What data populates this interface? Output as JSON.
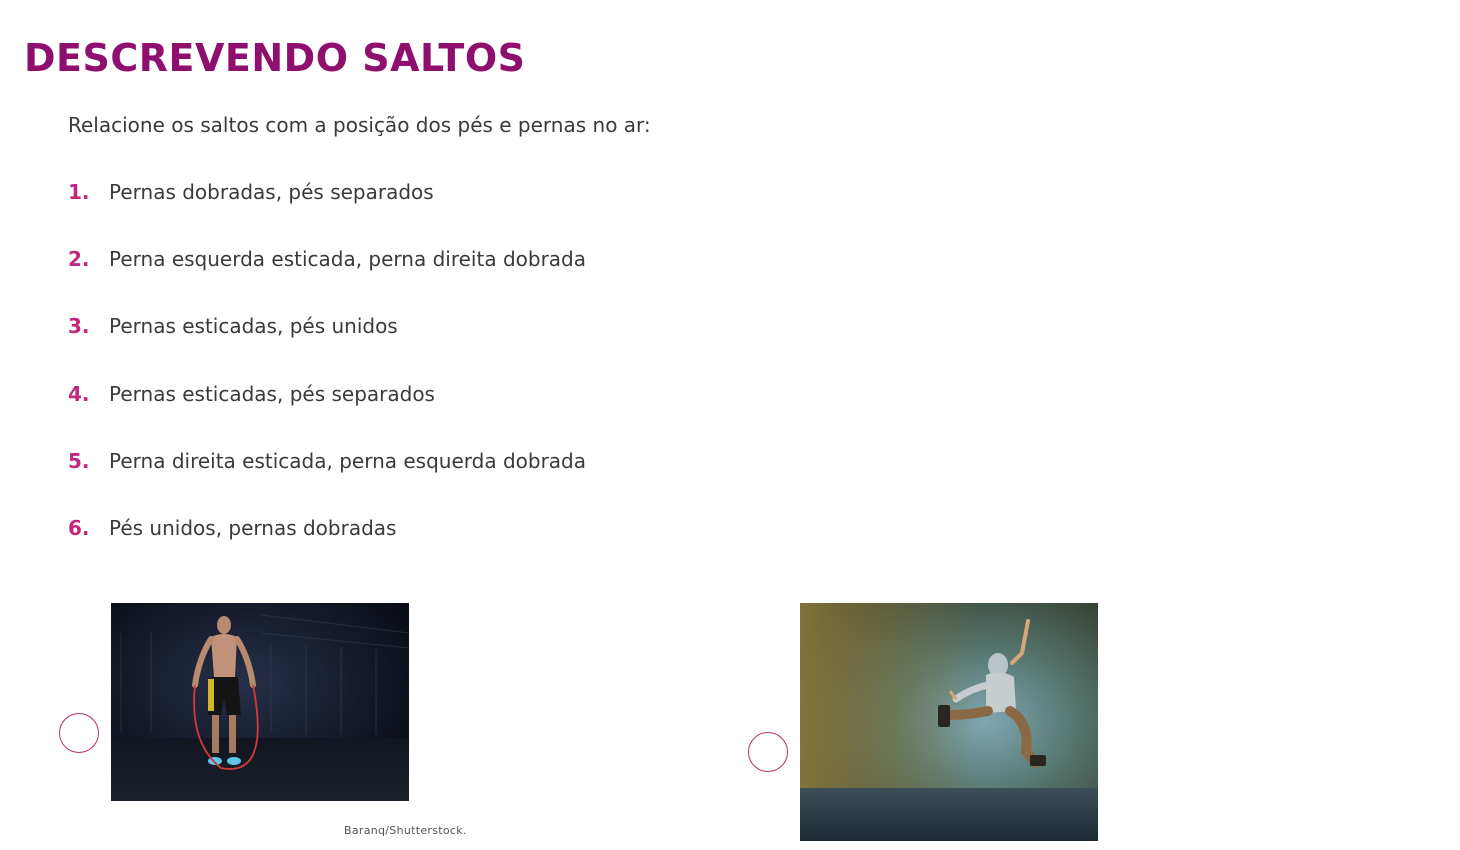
{
  "title": "DESCREVENDO SALTOS",
  "instruction": "Relacione os saltos com a posição dos pés e pernas no ar:",
  "options": [
    {
      "number": "1.",
      "text": "Pernas dobradas, pés separados"
    },
    {
      "number": "2.",
      "text": "Perna esquerda esticada, perna direita dobrada"
    },
    {
      "number": "3.",
      "text": "Pernas esticadas, pés unidos"
    },
    {
      "number": "4.",
      "text": "Pernas esticadas, pés separados"
    },
    {
      "number": "5.",
      "text": "Perna direita esticada, perna esquerda dobrada"
    },
    {
      "number": "6.",
      "text": "Pés unidos, pernas dobradas"
    }
  ],
  "photos": [
    {
      "subject": "man jumping rope"
    },
    {
      "subject": "dancer in hoodie jumping"
    }
  ],
  "credit": "Baranq/Shutterstock.",
  "colors": {
    "title": "#8e0f6e",
    "number": "#c2267f",
    "text": "#3a3a3a",
    "circle_border": "#b5306f"
  }
}
